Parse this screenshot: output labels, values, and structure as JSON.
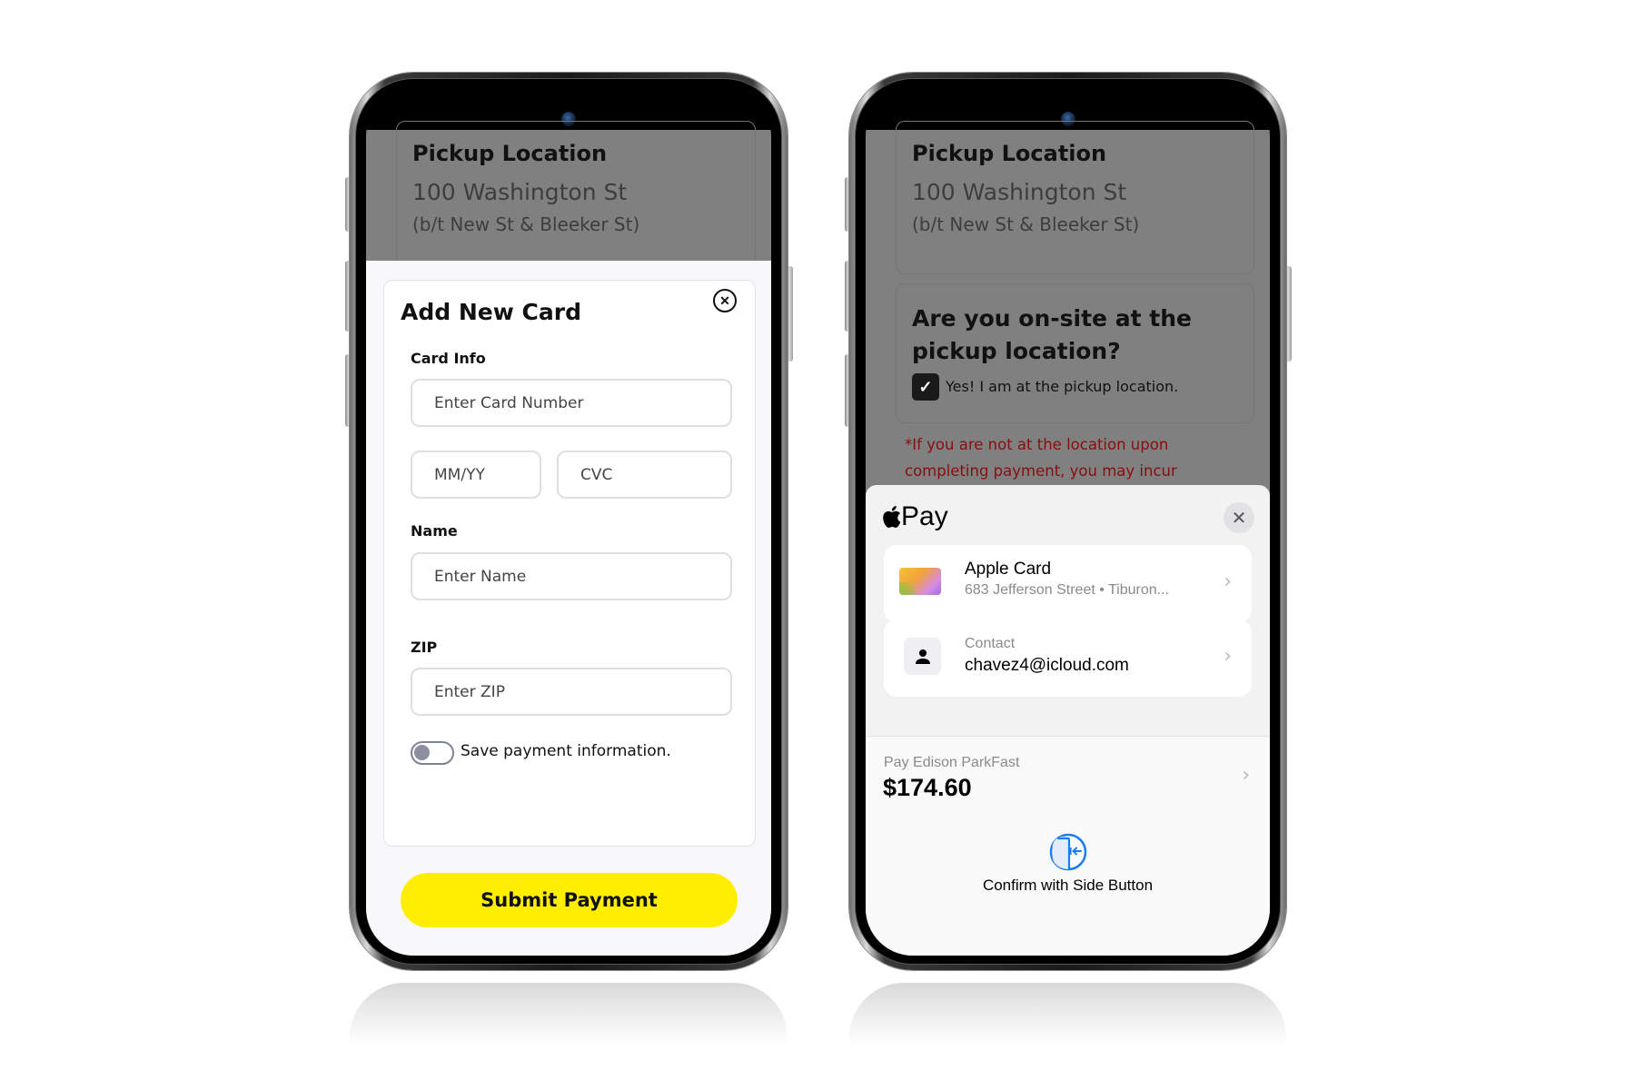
{
  "left_phone": {
    "background": {
      "pickup_title": "Pickup Location",
      "pickup_address": "100 Washington St",
      "pickup_cross_streets": "(b/t New St & Bleeker St)"
    },
    "modal": {
      "title": "Add New Card",
      "close_icon": "close-circle-icon",
      "card_info_label": "Card Info",
      "card_number_placeholder": "Enter Card Number",
      "expiry_placeholder": "MM/YY",
      "cvc_placeholder": "CVC",
      "name_label": "Name",
      "name_placeholder": "Enter Name",
      "zip_label": "ZIP",
      "zip_placeholder": "Enter ZIP",
      "save_toggle_label": "Save payment information.",
      "save_toggle_on": false,
      "submit_label": "Submit Payment"
    }
  },
  "right_phone": {
    "background": {
      "pickup_title": "Pickup Location",
      "pickup_address": "100 Washington St",
      "pickup_cross_streets": "(b/t New St & Bleeker St)",
      "onsite_question": "Are you on-site at the pickup location?",
      "onsite_checkbox_label": "Yes! I am at the pickup location.",
      "onsite_checked": true,
      "warning_text": "*If you are not at the location upon completing payment, you may incur"
    },
    "apple_pay": {
      "logo_text": "Pay",
      "close_icon": "close-icon",
      "card_row": {
        "title": "Apple Card",
        "subtitle": "683 Jefferson Street • Tiburon..."
      },
      "contact_row": {
        "label": "Contact",
        "value": "chavez4@icloud.com"
      },
      "pay_label": "Pay Edison ParkFast",
      "amount": "$174.60",
      "confirm_label": "Confirm with Side Button"
    }
  },
  "colors": {
    "submit_yellow": "#ffee00",
    "warning_red": "#8a0d0d",
    "confirm_blue": "#1a7cf5",
    "overlay_gray": "#808080"
  }
}
